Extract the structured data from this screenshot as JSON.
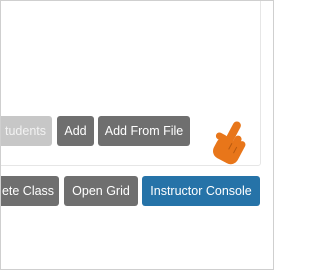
{
  "row1": {
    "students_label": "tudents",
    "add_label": "Add",
    "add_from_file_label": "Add From File"
  },
  "row2": {
    "delete_class_label": "ete Class",
    "open_grid_label": "Open Grid",
    "instructor_console_label": "Instructor Console"
  },
  "colors": {
    "button_dark": "#6f6f6f",
    "button_disabled": "#c7c7c7",
    "button_primary": "#2673a8",
    "pointer": "#e8761a"
  },
  "icons": {
    "pointer": "hand-pointer-icon"
  }
}
